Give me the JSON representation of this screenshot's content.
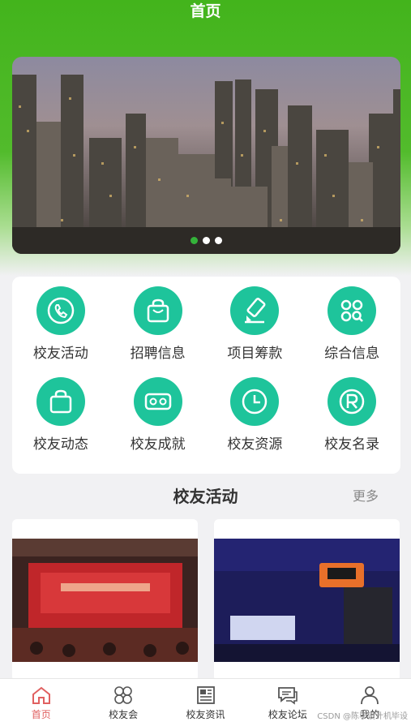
{
  "header": {
    "title": "首页"
  },
  "banner": {
    "dots": 3,
    "active_dot": 0
  },
  "menu": {
    "items": [
      {
        "label": "校友活动",
        "icon": "phone-icon"
      },
      {
        "label": "招聘信息",
        "icon": "bag-icon"
      },
      {
        "label": "项目筹款",
        "icon": "brush-icon"
      },
      {
        "label": "综合信息",
        "icon": "grid-search-icon"
      },
      {
        "label": "校友动态",
        "icon": "bag-icon"
      },
      {
        "label": "校友成就",
        "icon": "vr-glasses-icon"
      },
      {
        "label": "校友资源",
        "icon": "clock-icon"
      },
      {
        "label": "校友名录",
        "icon": "registered-icon"
      }
    ]
  },
  "section": {
    "title": "校友活动",
    "more": "更多"
  },
  "tabbar": {
    "items": [
      {
        "label": "首页",
        "icon": "home-icon",
        "active": true
      },
      {
        "label": "校友会",
        "icon": "clover-icon",
        "active": false
      },
      {
        "label": "校友资讯",
        "icon": "news-icon",
        "active": false
      },
      {
        "label": "校友论坛",
        "icon": "chat-icon",
        "active": false
      },
      {
        "label": "我的",
        "icon": "user-icon",
        "active": false
      }
    ]
  },
  "watermark": "CSDN @陈毕设计机毕设",
  "colors": {
    "brand_green": "#43b41c",
    "icon_teal": "#1ec49b",
    "active_tab": "#e06060"
  }
}
